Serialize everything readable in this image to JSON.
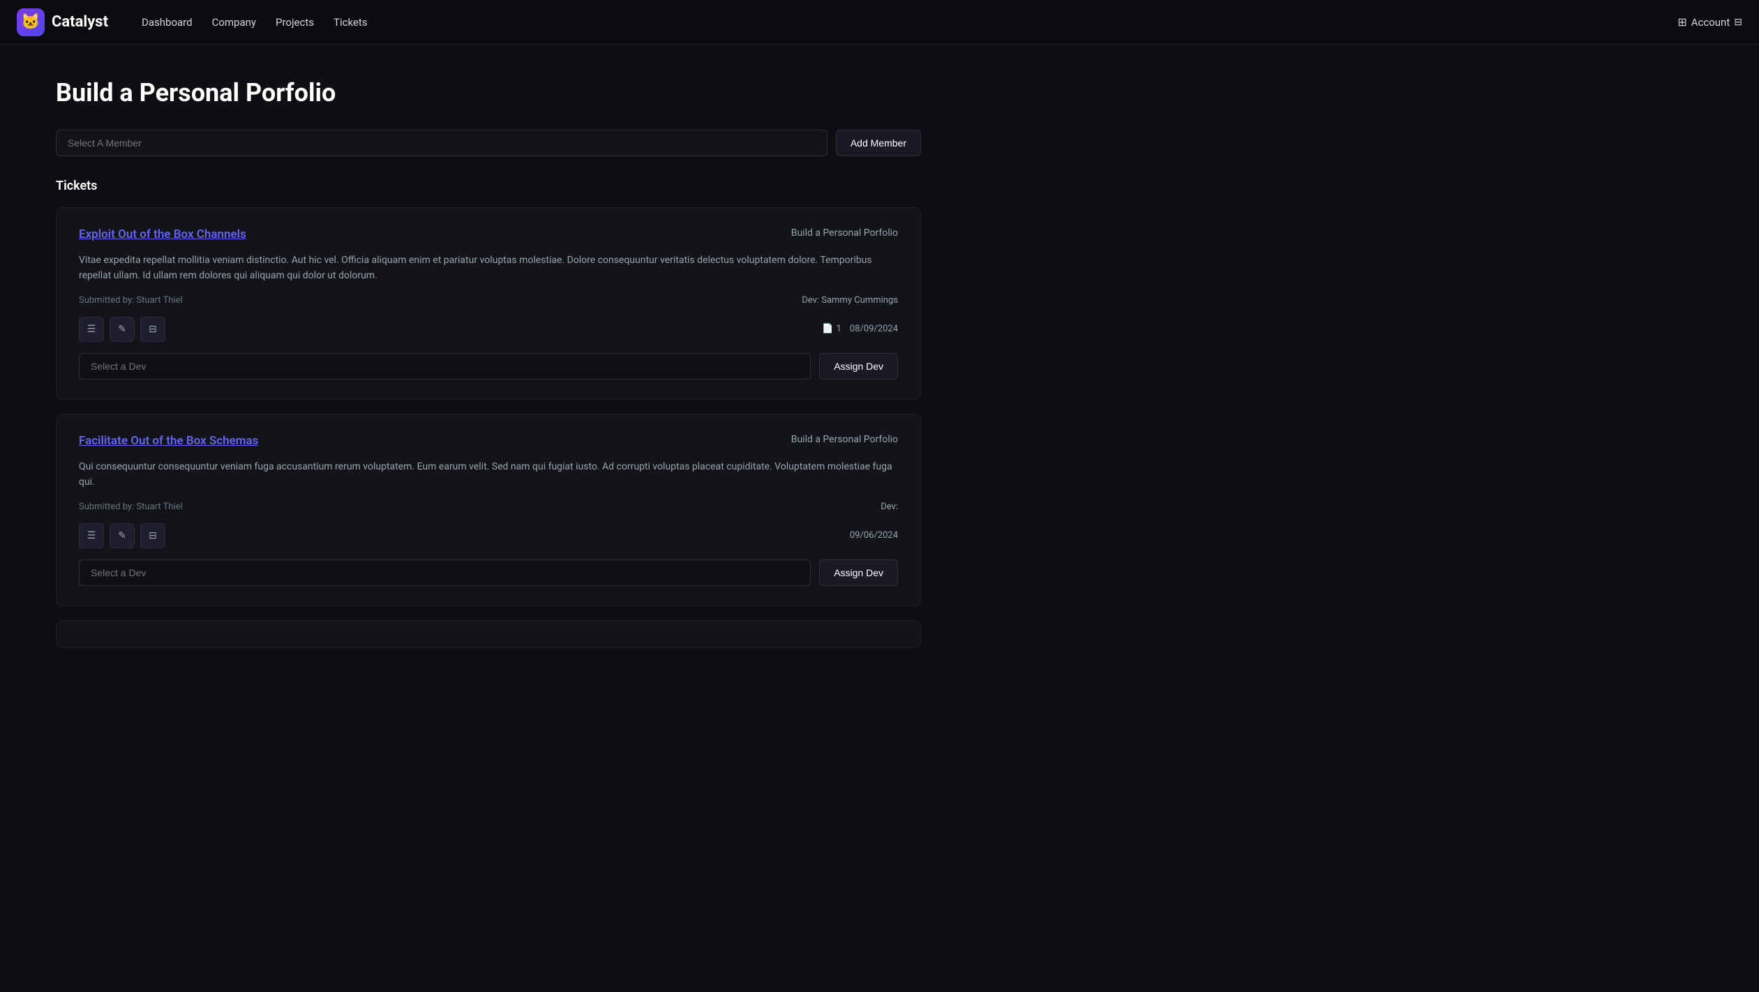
{
  "app": {
    "logo_emoji": "🐱",
    "logo_text": "Catalyst"
  },
  "nav": {
    "links": [
      {
        "label": "Dashboard",
        "id": "dashboard"
      },
      {
        "label": "Company",
        "id": "company"
      },
      {
        "label": "Projects",
        "id": "projects"
      },
      {
        "label": "Tickets",
        "id": "tickets"
      }
    ],
    "account_label": "Account",
    "account_icon": "⊞"
  },
  "page": {
    "title": "Build a Personal Porfolio",
    "member_input_placeholder": "Select A Member",
    "add_member_button": "Add Member",
    "tickets_section_label": "Tickets"
  },
  "tickets": [
    {
      "id": "ticket-1",
      "title": "Exploit Out of the Box Channels",
      "project": "Build a Personal Porfolio",
      "description": "Vitae expedita repellat mollitia veniam distinctio. Aut hic vel. Officia aliquam enim et pariatur voluptas molestiae. Dolore consequuntur veritatis delectus voluptatem dolore. Temporibus repellat ullam. Id ullam rem dolores qui aliquam qui dolor ut dolorum.",
      "submitted_by": "Submitted by: Stuart Thiel",
      "dev_label": "Dev: Sammy Cummings",
      "file_count": "1",
      "date": "08/09/2024",
      "select_dev_placeholder": "Select a Dev",
      "assign_dev_button": "Assign Dev"
    },
    {
      "id": "ticket-2",
      "title": "Facilitate Out of the Box Schemas",
      "project": "Build a Personal Porfolio",
      "description": "Qui consequuntur consequuntur veniam fuga accusantium rerum voluptatem. Eum earum velit. Sed nam qui fugiat iusto. Ad corrupti voluptas placeat cupiditate. Voluptatem molestiae fuga qui.",
      "submitted_by": "Submitted by: Stuart Thiel",
      "dev_label": "Dev:",
      "file_count": null,
      "date": "09/06/2024",
      "select_dev_placeholder": "Select a Dev",
      "assign_dev_button": "Assign Dev"
    }
  ]
}
